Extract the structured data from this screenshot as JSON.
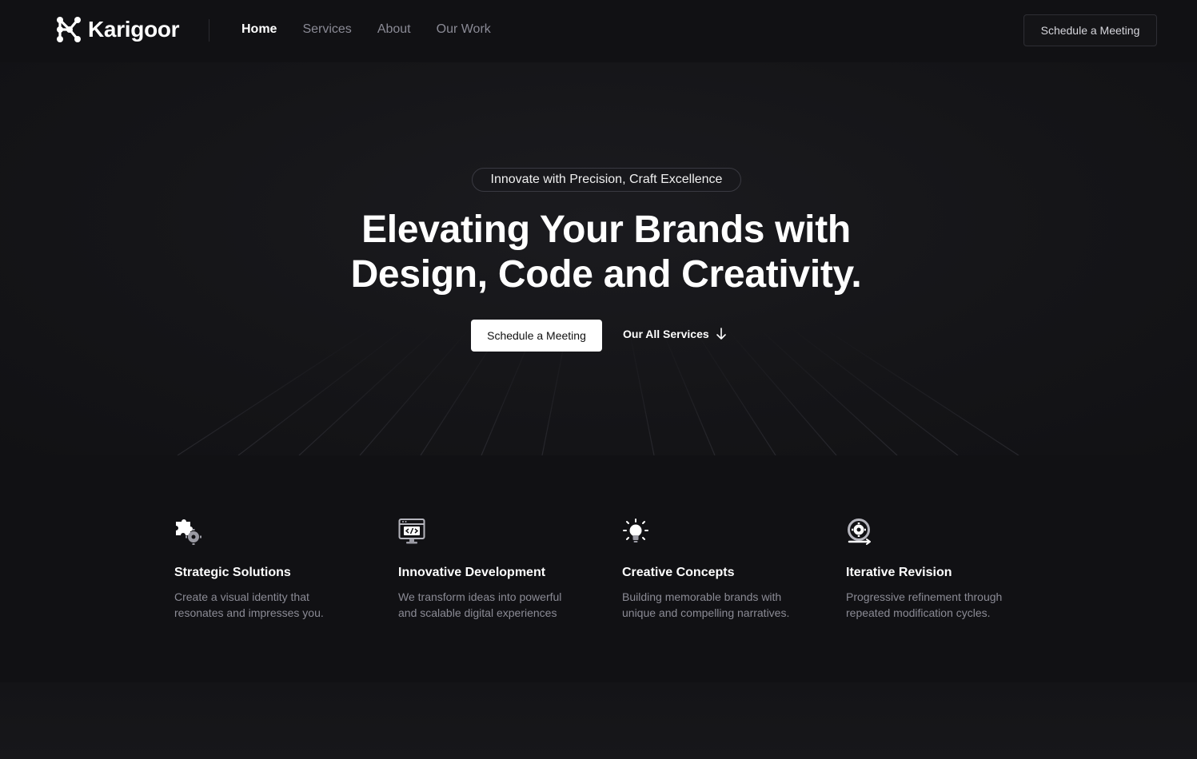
{
  "brand": {
    "name": "Karigoor"
  },
  "nav": {
    "links": [
      {
        "label": "Home",
        "active": true
      },
      {
        "label": "Services",
        "active": false
      },
      {
        "label": "About",
        "active": false
      },
      {
        "label": "Our Work",
        "active": false
      }
    ],
    "cta_label": "Schedule a Meeting"
  },
  "hero": {
    "badge": "Innovate with Precision, Craft Excellence",
    "title_line1": "Elevating Your Brands with",
    "title_line2": "Design, Code and Creativity.",
    "primary_cta": "Schedule a Meeting",
    "secondary_cta": "Our All Services"
  },
  "features": [
    {
      "icon": "puzzle-gear-icon",
      "title": "Strategic Solutions",
      "desc": "Create a visual identity that resonates and impresses you."
    },
    {
      "icon": "code-window-icon",
      "title": "Innovative Development",
      "desc": "We transform ideas into powerful and scalable digital experiences"
    },
    {
      "icon": "lightbulb-icon",
      "title": "Creative Concepts",
      "desc": "Building memorable brands with unique and compelling narratives."
    },
    {
      "icon": "revision-cycle-icon",
      "title": "Iterative Revision",
      "desc": "Progressive refinement through repeated modification cycles."
    }
  ],
  "colors": {
    "background": "#111114",
    "muted_text": "#8b8b95",
    "primary_button": "#ffffff"
  }
}
